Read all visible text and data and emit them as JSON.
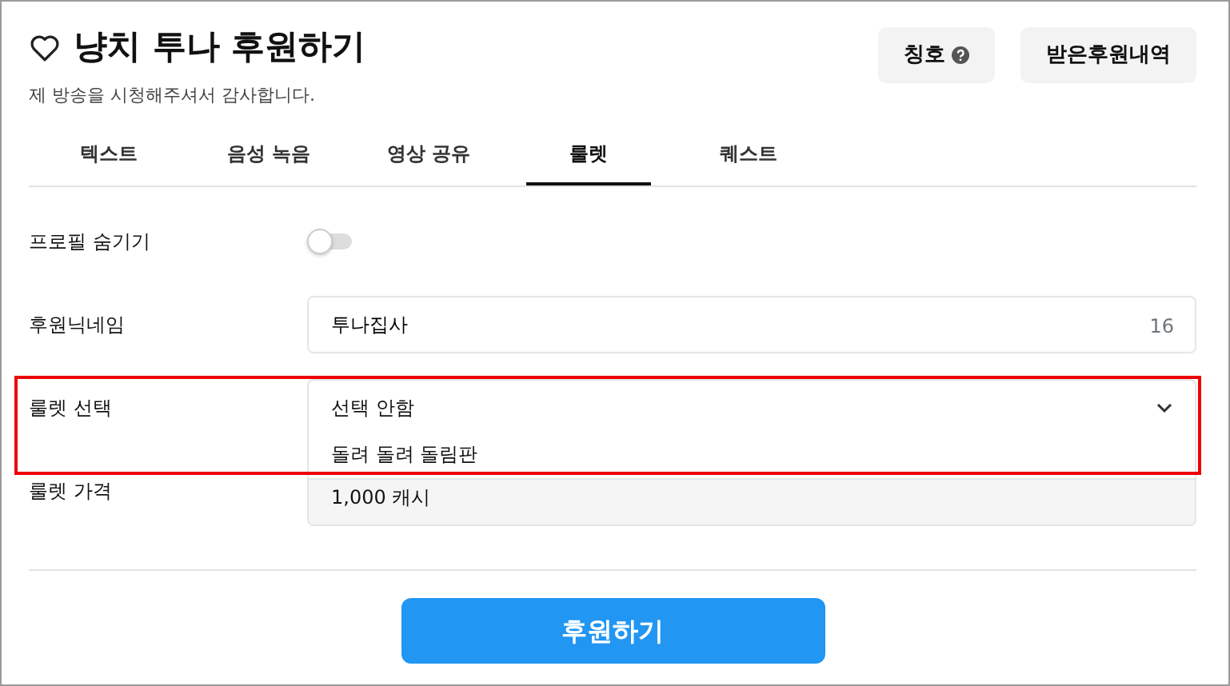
{
  "header": {
    "title": "냥치 투나 후원하기",
    "subtitle": "제 방송을 시청해주셔서 감사합니다.",
    "buttons": [
      {
        "label": "칭호",
        "kind": "help"
      },
      {
        "label": "받은후원내역",
        "kind": "plain"
      }
    ]
  },
  "tabs": [
    {
      "label": "텍스트",
      "selected": false
    },
    {
      "label": "음성 녹음",
      "selected": false
    },
    {
      "label": "영상 공유",
      "selected": false
    },
    {
      "label": "룰렛",
      "selected": true
    },
    {
      "label": "퀘스트",
      "selected": false
    }
  ],
  "form": {
    "rows": [
      {
        "kind": "toggle",
        "label": "프로필 숨기기",
        "on": false
      },
      {
        "kind": "text",
        "label": "후원닉네임",
        "value": "투나집사",
        "counter": "16"
      },
      {
        "kind": "select",
        "label": "룰렛 선택",
        "value": "선택 안함",
        "expanded": true,
        "highlighted": true,
        "options": [
          "돌려 돌려 돌림판"
        ]
      },
      {
        "kind": "readonly",
        "label": "룰렛 가격",
        "value": "1,000 캐시"
      }
    ]
  },
  "submit": "후원하기"
}
